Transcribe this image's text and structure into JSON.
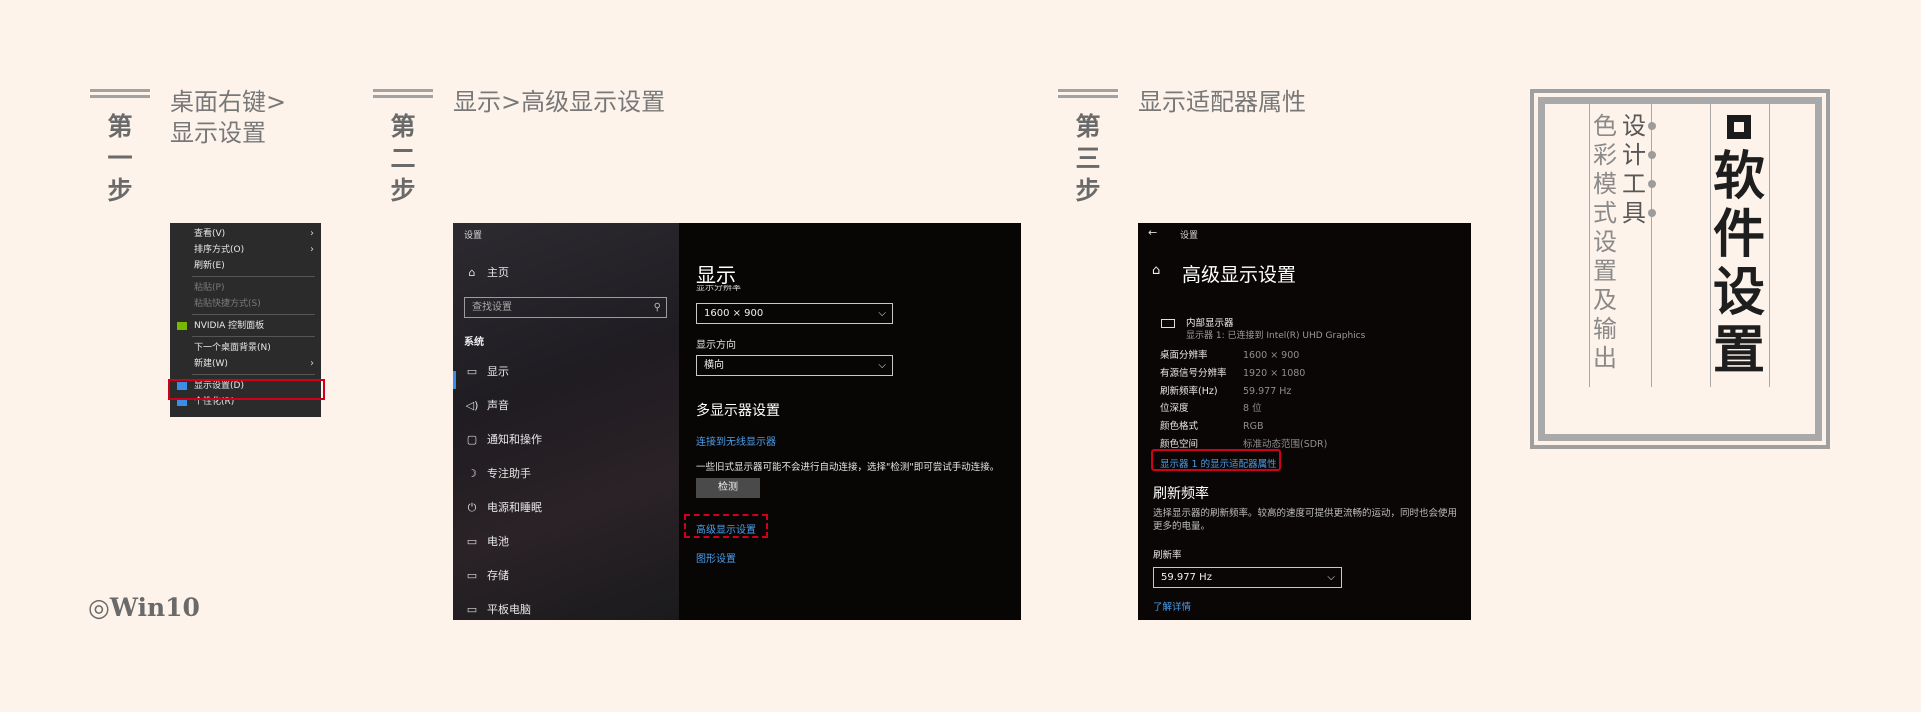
{
  "steps": [
    {
      "label": "第一步",
      "title_lines": [
        "桌面右键>",
        "显示设置"
      ]
    },
    {
      "label": "第二步",
      "title": "显示>高级显示设置"
    },
    {
      "label": "第三步",
      "title": "显示适配器属性"
    }
  ],
  "footer": {
    "os_label": "◎Win10"
  },
  "context_menu": {
    "items": [
      {
        "label": "查看(V)",
        "submenu": true
      },
      {
        "label": "排序方式(O)",
        "submenu": true
      },
      {
        "label": "刷新(E)"
      },
      {
        "label": "粘贴(P)",
        "disabled": true
      },
      {
        "label": "粘贴快捷方式(S)",
        "disabled": true
      },
      {
        "label": "NVIDIA 控制面板",
        "icon": "nvidia-icon"
      },
      {
        "label": "下一个桌面背景(N)"
      },
      {
        "label": "新建(W)",
        "submenu": true
      },
      {
        "label": "显示设置(D)",
        "icon": "display-settings-icon",
        "highlighted": true
      },
      {
        "label": "个性化(R)",
        "icon": "personalize-icon"
      }
    ],
    "submenu_arrow": "›",
    "accent_color": "#d0001a"
  },
  "settings_window": {
    "title": "设置",
    "home": "主页",
    "search_placeholder": "查找设置",
    "section": "系统",
    "nav": [
      {
        "label": "显示",
        "icon": "monitor-icon",
        "glyph": "▭"
      },
      {
        "label": "声音",
        "icon": "speaker-icon",
        "glyph": "◁)"
      },
      {
        "label": "通知和操作",
        "icon": "notification-icon",
        "glyph": "▢"
      },
      {
        "label": "专注助手",
        "icon": "moon-icon",
        "glyph": "☽"
      },
      {
        "label": "电源和睡眠",
        "icon": "power-icon",
        "glyph": "⏻"
      },
      {
        "label": "电池",
        "icon": "battery-icon",
        "glyph": "▭"
      },
      {
        "label": "存储",
        "icon": "storage-icon",
        "glyph": "▭"
      },
      {
        "label": "平板电脑",
        "icon": "tablet-icon",
        "glyph": "▭"
      }
    ],
    "page_title": "显示",
    "resolution_label": "显示分辨率",
    "resolution_value": "1600 × 900",
    "orientation_label": "显示方向",
    "orientation_value": "横向",
    "multi_display_heading": "多显示器设置",
    "wireless_link": "连接到无线显示器",
    "legacy_note": "一些旧式显示器可能不会进行自动连接，选择\"检测\"即可尝试手动连接。",
    "detect_button": "检测",
    "advanced_link": "高级显示设置",
    "graphics_link": "图形设置",
    "accent_color": "#4a9eea"
  },
  "advanced_window": {
    "back": "←",
    "title": "设置",
    "page_title": "高级显示设置",
    "display_name": "内部显示器",
    "display_sub": "显示器 1: 已连接到 Intel(R) UHD Graphics",
    "rows": [
      {
        "key": "桌面分辨率",
        "value": "1600 × 900"
      },
      {
        "key": "有源信号分辨率",
        "value": "1920 × 1080"
      },
      {
        "key": "刷新频率(Hz)",
        "value": "59.977 Hz"
      },
      {
        "key": "位深度",
        "value": "8 位"
      },
      {
        "key": "颜色格式",
        "value": "RGB"
      },
      {
        "key": "颜色空间",
        "value": "标准动态范围(SDR)"
      }
    ],
    "adapter_link": "显示器 1 的显示适配器属性",
    "refresh_heading": "刷新频率",
    "refresh_desc": "选择显示器的刷新频率。较高的速度可提供更流畅的运动，同时也会使用更多的电量。",
    "refresh_label": "刷新率",
    "refresh_value": "59.977 Hz",
    "learn_more": "了解详情"
  },
  "deco_panel": {
    "title_icon": "■",
    "title": "软件设置",
    "col1": "设计工具",
    "col2": "色彩模式设置及输出"
  }
}
